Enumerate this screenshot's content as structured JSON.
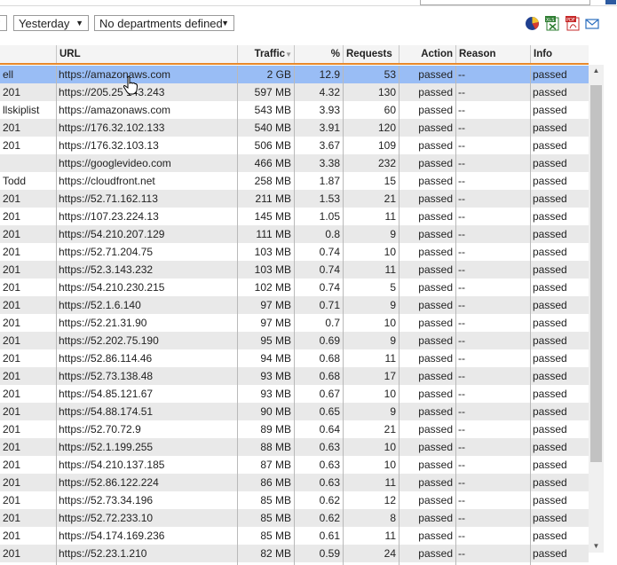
{
  "toolbar": {
    "period_value": "Yesterday",
    "department_value": "No departments defined",
    "icons": [
      "chart-icon",
      "xls-export-icon",
      "pdf-export-icon",
      "email-icon"
    ]
  },
  "table": {
    "columns": {
      "user": "",
      "url": "URL",
      "traffic": "Traffic",
      "percent": "%",
      "requests": "Requests",
      "action": "Action",
      "reason": "Reason",
      "info": "Info"
    },
    "sort_indicator": "▼",
    "rows": [
      {
        "user": "ell",
        "url": "https://amazonaws.com",
        "traffic": "2 GB",
        "percent": "12.9",
        "requests": "53",
        "action": "passed",
        "reason": "--",
        "info": "passed"
      },
      {
        "user": "201",
        "url": "https://205.25 143.243",
        "traffic": "597 MB",
        "percent": "4.32",
        "requests": "130",
        "action": "passed",
        "reason": "--",
        "info": "passed"
      },
      {
        "user": "llskiplist",
        "url": "https://amazonaws.com",
        "traffic": "543 MB",
        "percent": "3.93",
        "requests": "60",
        "action": "passed",
        "reason": "--",
        "info": "passed"
      },
      {
        "user": "201",
        "url": "https://176.32.102.133",
        "traffic": "540 MB",
        "percent": "3.91",
        "requests": "120",
        "action": "passed",
        "reason": "--",
        "info": "passed"
      },
      {
        "user": "201",
        "url": "https://176.32.103.13",
        "traffic": "506 MB",
        "percent": "3.67",
        "requests": "109",
        "action": "passed",
        "reason": "--",
        "info": "passed"
      },
      {
        "user": "",
        "url": "https://googlevideo.com",
        "traffic": "466 MB",
        "percent": "3.38",
        "requests": "232",
        "action": "passed",
        "reason": "--",
        "info": "passed"
      },
      {
        "user": "Todd",
        "url": "https://cloudfront.net",
        "traffic": "258 MB",
        "percent": "1.87",
        "requests": "15",
        "action": "passed",
        "reason": "--",
        "info": "passed"
      },
      {
        "user": "201",
        "url": "https://52.71.162.113",
        "traffic": "211 MB",
        "percent": "1.53",
        "requests": "21",
        "action": "passed",
        "reason": "--",
        "info": "passed"
      },
      {
        "user": "201",
        "url": "https://107.23.224.13",
        "traffic": "145 MB",
        "percent": "1.05",
        "requests": "11",
        "action": "passed",
        "reason": "--",
        "info": "passed"
      },
      {
        "user": "201",
        "url": "https://54.210.207.129",
        "traffic": "111 MB",
        "percent": "0.8",
        "requests": "9",
        "action": "passed",
        "reason": "--",
        "info": "passed"
      },
      {
        "user": "201",
        "url": "https://52.71.204.75",
        "traffic": "103 MB",
        "percent": "0.74",
        "requests": "10",
        "action": "passed",
        "reason": "--",
        "info": "passed"
      },
      {
        "user": "201",
        "url": "https://52.3.143.232",
        "traffic": "103 MB",
        "percent": "0.74",
        "requests": "11",
        "action": "passed",
        "reason": "--",
        "info": "passed"
      },
      {
        "user": "201",
        "url": "https://54.210.230.215",
        "traffic": "102 MB",
        "percent": "0.74",
        "requests": "5",
        "action": "passed",
        "reason": "--",
        "info": "passed"
      },
      {
        "user": "201",
        "url": "https://52.1.6.140",
        "traffic": "97 MB",
        "percent": "0.71",
        "requests": "9",
        "action": "passed",
        "reason": "--",
        "info": "passed"
      },
      {
        "user": "201",
        "url": "https://52.21.31.90",
        "traffic": "97 MB",
        "percent": "0.7",
        "requests": "10",
        "action": "passed",
        "reason": "--",
        "info": "passed"
      },
      {
        "user": "201",
        "url": "https://52.202.75.190",
        "traffic": "95 MB",
        "percent": "0.69",
        "requests": "9",
        "action": "passed",
        "reason": "--",
        "info": "passed"
      },
      {
        "user": "201",
        "url": "https://52.86.114.46",
        "traffic": "94 MB",
        "percent": "0.68",
        "requests": "11",
        "action": "passed",
        "reason": "--",
        "info": "passed"
      },
      {
        "user": "201",
        "url": "https://52.73.138.48",
        "traffic": "93 MB",
        "percent": "0.68",
        "requests": "17",
        "action": "passed",
        "reason": "--",
        "info": "passed"
      },
      {
        "user": "201",
        "url": "https://54.85.121.67",
        "traffic": "93 MB",
        "percent": "0.67",
        "requests": "10",
        "action": "passed",
        "reason": "--",
        "info": "passed"
      },
      {
        "user": "201",
        "url": "https://54.88.174.51",
        "traffic": "90 MB",
        "percent": "0.65",
        "requests": "9",
        "action": "passed",
        "reason": "--",
        "info": "passed"
      },
      {
        "user": "201",
        "url": "https://52.70.72.9",
        "traffic": "89 MB",
        "percent": "0.64",
        "requests": "21",
        "action": "passed",
        "reason": "--",
        "info": "passed"
      },
      {
        "user": "201",
        "url": "https://52.1.199.255",
        "traffic": "88 MB",
        "percent": "0.63",
        "requests": "10",
        "action": "passed",
        "reason": "--",
        "info": "passed"
      },
      {
        "user": "201",
        "url": "https://54.210.137.185",
        "traffic": "87 MB",
        "percent": "0.63",
        "requests": "10",
        "action": "passed",
        "reason": "--",
        "info": "passed"
      },
      {
        "user": "201",
        "url": "https://52.86.122.224",
        "traffic": "86 MB",
        "percent": "0.63",
        "requests": "11",
        "action": "passed",
        "reason": "--",
        "info": "passed"
      },
      {
        "user": "201",
        "url": "https://52.73.34.196",
        "traffic": "85 MB",
        "percent": "0.62",
        "requests": "12",
        "action": "passed",
        "reason": "--",
        "info": "passed"
      },
      {
        "user": "201",
        "url": "https://52.72.233.10",
        "traffic": "85 MB",
        "percent": "0.62",
        "requests": "8",
        "action": "passed",
        "reason": "--",
        "info": "passed"
      },
      {
        "user": "201",
        "url": "https://54.174.169.236",
        "traffic": "85 MB",
        "percent": "0.61",
        "requests": "11",
        "action": "passed",
        "reason": "--",
        "info": "passed"
      },
      {
        "user": "201",
        "url": "https://52.23.1.210",
        "traffic": "82 MB",
        "percent": "0.59",
        "requests": "24",
        "action": "passed",
        "reason": "--",
        "info": "passed"
      }
    ]
  },
  "colors": {
    "header_underline": "#e8892b",
    "selected_row": "#99bdf5",
    "alt_row": "#e9e9e9"
  }
}
